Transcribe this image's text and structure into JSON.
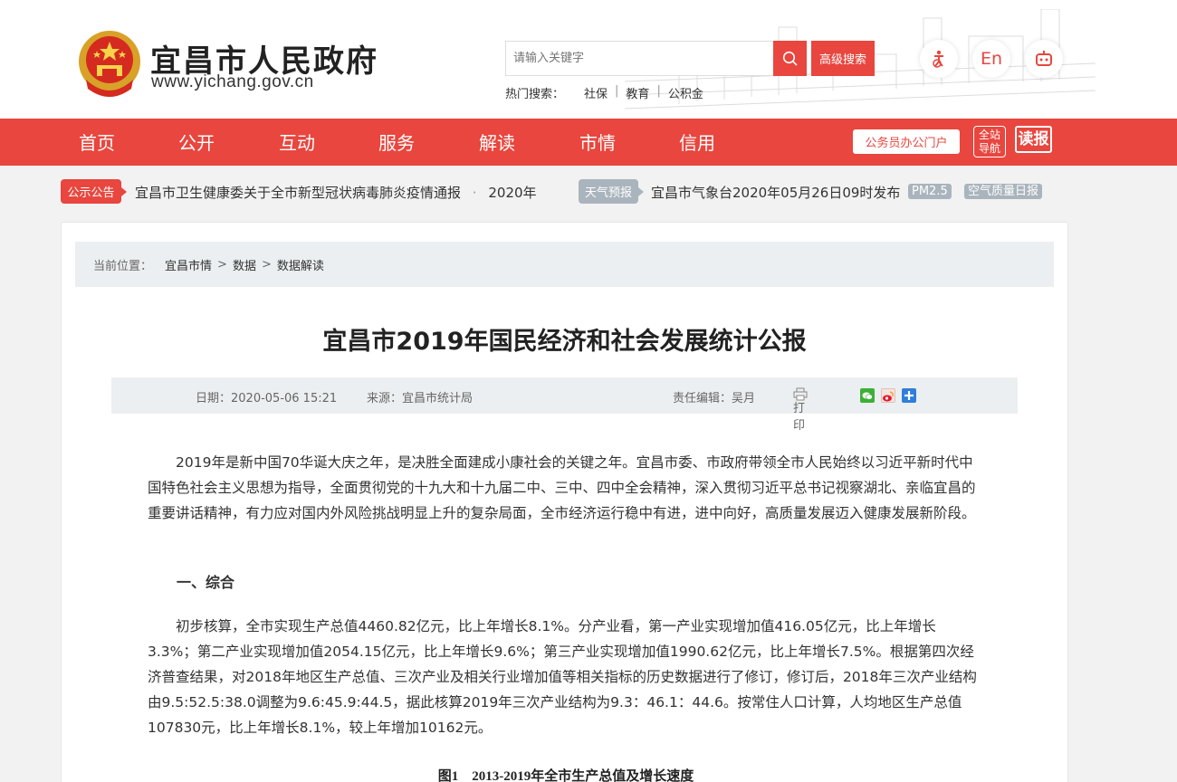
{
  "header": {
    "site_name": "宜昌市人民政府",
    "site_url": "www.yichang.gov.cn",
    "search_placeholder": "请输入关键字",
    "advanced_search": "高级搜索",
    "hot_label": "热门搜索：",
    "hot_items": [
      "社保",
      "教育",
      "公积金"
    ],
    "english_label": "En",
    "icons": [
      "accessibility-icon",
      "robot-icon"
    ]
  },
  "nav": {
    "items": [
      "首页",
      "公开",
      "互动",
      "服务",
      "解读",
      "市情",
      "信用"
    ],
    "portal": "公务员办公门户",
    "sitemap": "全站导航",
    "sitemap_line1": "全站",
    "sitemap_line2": "导航",
    "dubao": "读报"
  },
  "notice": {
    "label": "公示公告",
    "text": "宜昌市卫生健康委关于全市新型冠状病毒肺炎疫情通报",
    "bullet": "·",
    "text2": "2020年",
    "weather_label": "天气预报",
    "weather_text": "宜昌市气象台2020年05月26日09时发布",
    "pm25": "PM2.5",
    "air_quality": "空气质量日报"
  },
  "breadcrumb": {
    "label": "当前位置：",
    "items": [
      "宜昌市情",
      "数据",
      "数据解读"
    ],
    "separator": ">"
  },
  "article": {
    "title": "宜昌市2019年国民经济和社会发展统计公报",
    "date": "日期：2020-05-06 15:21",
    "source": "来源：宜昌市统计局",
    "editor": "责任编辑：吴月",
    "print": "打印",
    "para1": "2019年是新中国70华诞大庆之年，是决胜全面建成小康社会的关键之年。宜昌市委、市政府带领全市人民始终以习近平新时代中国特色社会主义思想为指导，全面贯彻党的十九大和十九届二中、三中、四中全会精神，深入贯彻习近平总书记视察湖北、亲临宜昌的重要讲话精神，有力应对国内外风险挑战明显上升的复杂局面，全市经济运行稳中有进，进中向好，高质量发展迈入健康发展新阶段。",
    "section1": "一、综合",
    "para2": "初步核算，全市实现生产总值4460.82亿元，比上年增长8.1%。分产业看，第一产业实现增加值416.05亿元，比上年增长3.3%；第二产业实现增加值2054.15亿元，比上年增长9.6%；第三产业实现增加值1990.62亿元，比上年增长7.5%。根据第四次经济普查结果，对2018年地区生产总值、三次产业及相关行业增加值等相关指标的历史数据进行了修订，修订后，2018年三次产业结构由9.5:52.5:38.0调整为9.6:45.9:44.5，据此核算2019年三次产业结构为9.3：46.1：44.6。按常住人口计算，人均地区生产总值107830元，比上年增长8.1%，较上年增加10162元。",
    "figure_caption": "图1　2013-2019年全市生产总值及增长速度"
  },
  "colors": {
    "brand_red": "#e8463e",
    "gray_badge": "#aab4bd",
    "meta_bg": "#eceff1"
  }
}
